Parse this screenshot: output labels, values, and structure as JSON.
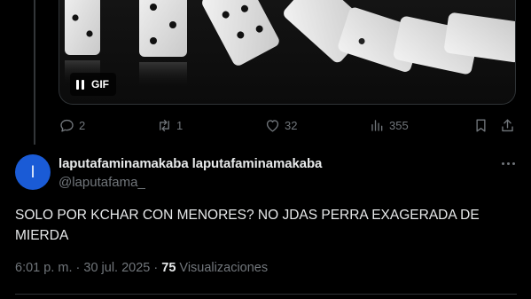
{
  "media": {
    "badge_label": "GIF"
  },
  "actions": {
    "replies": "2",
    "reposts": "1",
    "likes": "32",
    "views": "355"
  },
  "tweet": {
    "avatar_letter": "l",
    "avatar_color": "#1a5bd6",
    "display_name": "laputafaminamakaba laputafaminamakaba",
    "handle": "@laputafama_",
    "text": "SOLO POR KCHAR CON MENORES? NO JDAS PERRA EXAGERADA DE MIERDA",
    "time": "6:01 p. m.",
    "separator": " · ",
    "date": "30 jul. 2025",
    "views_count": "75",
    "views_label": "Visualizaciones"
  },
  "icons": [
    "pause-icon",
    "reply-icon",
    "repost-icon",
    "like-icon",
    "views-icon",
    "bookmark-icon",
    "share-icon",
    "more-icon"
  ]
}
